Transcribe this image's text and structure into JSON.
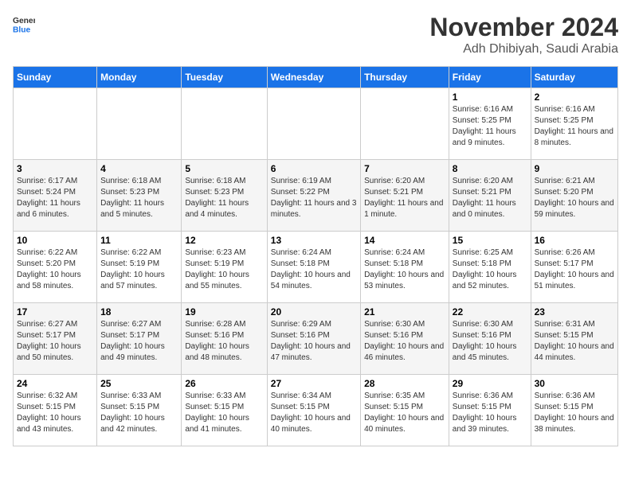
{
  "logo": {
    "general": "General",
    "blue": "Blue"
  },
  "title": "November 2024",
  "subtitle": "Adh Dhibiyah, Saudi Arabia",
  "days_of_week": [
    "Sunday",
    "Monday",
    "Tuesday",
    "Wednesday",
    "Thursday",
    "Friday",
    "Saturday"
  ],
  "rows": [
    [
      {
        "day": "",
        "info": ""
      },
      {
        "day": "",
        "info": ""
      },
      {
        "day": "",
        "info": ""
      },
      {
        "day": "",
        "info": ""
      },
      {
        "day": "",
        "info": ""
      },
      {
        "day": "1",
        "info": "Sunrise: 6:16 AM\nSunset: 5:25 PM\nDaylight: 11 hours and 9 minutes."
      },
      {
        "day": "2",
        "info": "Sunrise: 6:16 AM\nSunset: 5:25 PM\nDaylight: 11 hours and 8 minutes."
      }
    ],
    [
      {
        "day": "3",
        "info": "Sunrise: 6:17 AM\nSunset: 5:24 PM\nDaylight: 11 hours and 6 minutes."
      },
      {
        "day": "4",
        "info": "Sunrise: 6:18 AM\nSunset: 5:23 PM\nDaylight: 11 hours and 5 minutes."
      },
      {
        "day": "5",
        "info": "Sunrise: 6:18 AM\nSunset: 5:23 PM\nDaylight: 11 hours and 4 minutes."
      },
      {
        "day": "6",
        "info": "Sunrise: 6:19 AM\nSunset: 5:22 PM\nDaylight: 11 hours and 3 minutes."
      },
      {
        "day": "7",
        "info": "Sunrise: 6:20 AM\nSunset: 5:21 PM\nDaylight: 11 hours and 1 minute."
      },
      {
        "day": "8",
        "info": "Sunrise: 6:20 AM\nSunset: 5:21 PM\nDaylight: 11 hours and 0 minutes."
      },
      {
        "day": "9",
        "info": "Sunrise: 6:21 AM\nSunset: 5:20 PM\nDaylight: 10 hours and 59 minutes."
      }
    ],
    [
      {
        "day": "10",
        "info": "Sunrise: 6:22 AM\nSunset: 5:20 PM\nDaylight: 10 hours and 58 minutes."
      },
      {
        "day": "11",
        "info": "Sunrise: 6:22 AM\nSunset: 5:19 PM\nDaylight: 10 hours and 57 minutes."
      },
      {
        "day": "12",
        "info": "Sunrise: 6:23 AM\nSunset: 5:19 PM\nDaylight: 10 hours and 55 minutes."
      },
      {
        "day": "13",
        "info": "Sunrise: 6:24 AM\nSunset: 5:18 PM\nDaylight: 10 hours and 54 minutes."
      },
      {
        "day": "14",
        "info": "Sunrise: 6:24 AM\nSunset: 5:18 PM\nDaylight: 10 hours and 53 minutes."
      },
      {
        "day": "15",
        "info": "Sunrise: 6:25 AM\nSunset: 5:18 PM\nDaylight: 10 hours and 52 minutes."
      },
      {
        "day": "16",
        "info": "Sunrise: 6:26 AM\nSunset: 5:17 PM\nDaylight: 10 hours and 51 minutes."
      }
    ],
    [
      {
        "day": "17",
        "info": "Sunrise: 6:27 AM\nSunset: 5:17 PM\nDaylight: 10 hours and 50 minutes."
      },
      {
        "day": "18",
        "info": "Sunrise: 6:27 AM\nSunset: 5:17 PM\nDaylight: 10 hours and 49 minutes."
      },
      {
        "day": "19",
        "info": "Sunrise: 6:28 AM\nSunset: 5:16 PM\nDaylight: 10 hours and 48 minutes."
      },
      {
        "day": "20",
        "info": "Sunrise: 6:29 AM\nSunset: 5:16 PM\nDaylight: 10 hours and 47 minutes."
      },
      {
        "day": "21",
        "info": "Sunrise: 6:30 AM\nSunset: 5:16 PM\nDaylight: 10 hours and 46 minutes."
      },
      {
        "day": "22",
        "info": "Sunrise: 6:30 AM\nSunset: 5:16 PM\nDaylight: 10 hours and 45 minutes."
      },
      {
        "day": "23",
        "info": "Sunrise: 6:31 AM\nSunset: 5:15 PM\nDaylight: 10 hours and 44 minutes."
      }
    ],
    [
      {
        "day": "24",
        "info": "Sunrise: 6:32 AM\nSunset: 5:15 PM\nDaylight: 10 hours and 43 minutes."
      },
      {
        "day": "25",
        "info": "Sunrise: 6:33 AM\nSunset: 5:15 PM\nDaylight: 10 hours and 42 minutes."
      },
      {
        "day": "26",
        "info": "Sunrise: 6:33 AM\nSunset: 5:15 PM\nDaylight: 10 hours and 41 minutes."
      },
      {
        "day": "27",
        "info": "Sunrise: 6:34 AM\nSunset: 5:15 PM\nDaylight: 10 hours and 40 minutes."
      },
      {
        "day": "28",
        "info": "Sunrise: 6:35 AM\nSunset: 5:15 PM\nDaylight: 10 hours and 40 minutes."
      },
      {
        "day": "29",
        "info": "Sunrise: 6:36 AM\nSunset: 5:15 PM\nDaylight: 10 hours and 39 minutes."
      },
      {
        "day": "30",
        "info": "Sunrise: 6:36 AM\nSunset: 5:15 PM\nDaylight: 10 hours and 38 minutes."
      }
    ]
  ]
}
